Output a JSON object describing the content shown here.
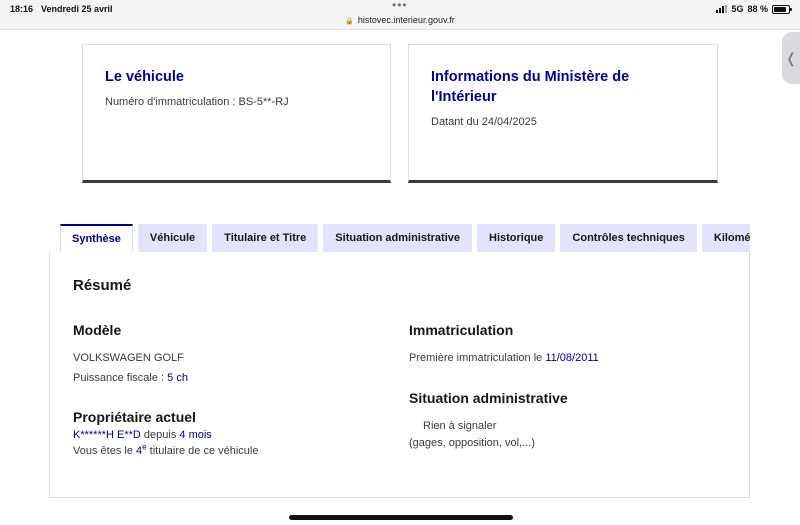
{
  "status_bar": {
    "time": "18:16",
    "date": "Vendredi 25 avril",
    "url": "histovec.interieur.gouv.fr",
    "network": "5G",
    "battery": "88 %",
    "battery_level": 0.88
  },
  "cards": {
    "vehicle": {
      "title": "Le véhicule",
      "subtitle": "Numéro d'immatriculation : BS-5**-RJ"
    },
    "ministry": {
      "title_line1": "Informations du Ministère de",
      "title_line2": "l'Intérieur",
      "subtitle": "Datant du 24/04/2025"
    }
  },
  "tabs": [
    {
      "label": "Synthèse",
      "active": true
    },
    {
      "label": "Véhicule",
      "active": false
    },
    {
      "label": "Titulaire et Titre",
      "active": false
    },
    {
      "label": "Situation administrative",
      "active": false
    },
    {
      "label": "Historique",
      "active": false
    },
    {
      "label": "Contrôles techniques",
      "active": false
    },
    {
      "label": "Kilométrage",
      "active": false
    }
  ],
  "summary": {
    "title": "Résumé",
    "model": {
      "heading": "Modèle",
      "name": "VOLKSWAGEN GOLF",
      "power_label": "Puissance fiscale : ",
      "power_value": "5 ch"
    },
    "owner": {
      "heading": "Propriétaire actuel",
      "name": "K******H E**D",
      "since_label": " depuis ",
      "since_value": "4 mois",
      "rank_prefix": "Vous êtes le ",
      "rank_value": "4",
      "rank_sup": "e",
      "rank_suffix": " titulaire de ce véhicule"
    },
    "registration": {
      "heading": "Immatriculation",
      "label": "Première immatriculation le ",
      "date": "11/08/2011"
    },
    "admin": {
      "heading": "Situation administrative",
      "status": "Rien à signaler",
      "detail": "(gages, opposition, vol,...)"
    }
  }
}
